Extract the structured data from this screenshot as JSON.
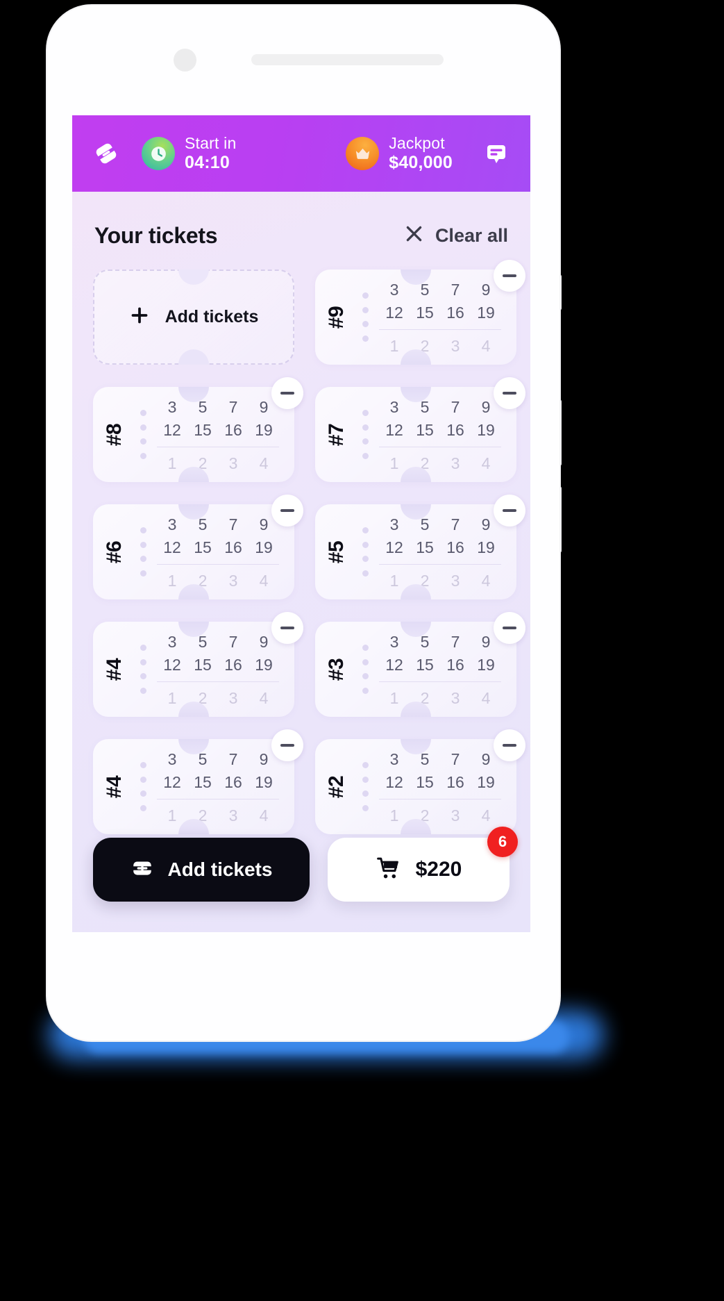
{
  "header": {
    "logo_icon": "ticket-icon",
    "clock_icon": "clock-icon",
    "crown_icon": "crown-icon",
    "chat_icon": "chat-bubble-icon",
    "start_label": "Start in",
    "start_value": "04:10",
    "jackpot_label": "Jackpot",
    "jackpot_value": "$40,000",
    "bar_color_from": "#c13ef0",
    "bar_color_to": "#a64cf5"
  },
  "section": {
    "title": "Your tickets",
    "clear_label": "Clear all",
    "close_icon": "close-x-icon"
  },
  "add_card": {
    "label": "Add tickets",
    "icon": "plus-icon"
  },
  "tickets": [
    {
      "id": "#9",
      "rows": [
        [
          "3",
          "5",
          "7",
          "9"
        ],
        [
          "12",
          "15",
          "16",
          "19"
        ],
        [
          "1",
          "2",
          "3",
          "4"
        ]
      ],
      "remove_icon": "minus-circle-icon"
    },
    {
      "id": "#8",
      "rows": [
        [
          "3",
          "5",
          "7",
          "9"
        ],
        [
          "12",
          "15",
          "16",
          "19"
        ],
        [
          "1",
          "2",
          "3",
          "4"
        ]
      ],
      "remove_icon": "minus-circle-icon"
    },
    {
      "id": "#7",
      "rows": [
        [
          "3",
          "5",
          "7",
          "9"
        ],
        [
          "12",
          "15",
          "16",
          "19"
        ],
        [
          "1",
          "2",
          "3",
          "4"
        ]
      ],
      "remove_icon": "minus-circle-icon"
    },
    {
      "id": "#6",
      "rows": [
        [
          "3",
          "5",
          "7",
          "9"
        ],
        [
          "12",
          "15",
          "16",
          "19"
        ],
        [
          "1",
          "2",
          "3",
          "4"
        ]
      ],
      "remove_icon": "minus-circle-icon"
    },
    {
      "id": "#5",
      "rows": [
        [
          "3",
          "5",
          "7",
          "9"
        ],
        [
          "12",
          "15",
          "16",
          "19"
        ],
        [
          "1",
          "2",
          "3",
          "4"
        ]
      ],
      "remove_icon": "minus-circle-icon"
    },
    {
      "id": "#4",
      "rows": [
        [
          "3",
          "5",
          "7",
          "9"
        ],
        [
          "12",
          "15",
          "16",
          "19"
        ],
        [
          "1",
          "2",
          "3",
          "4"
        ]
      ],
      "remove_icon": "minus-circle-icon"
    },
    {
      "id": "#3",
      "rows": [
        [
          "3",
          "5",
          "7",
          "9"
        ],
        [
          "12",
          "15",
          "16",
          "19"
        ],
        [
          "1",
          "2",
          "3",
          "4"
        ]
      ],
      "remove_icon": "minus-circle-icon"
    },
    {
      "id": "#4",
      "rows": [
        [
          "3",
          "5",
          "7",
          "9"
        ],
        [
          "12",
          "15",
          "16",
          "19"
        ],
        [
          "1",
          "2",
          "3",
          "4"
        ]
      ],
      "remove_icon": "minus-circle-icon"
    },
    {
      "id": "#2",
      "rows": [
        [
          "3",
          "5",
          "7",
          "9"
        ],
        [
          "12",
          "15",
          "16",
          "19"
        ],
        [
          "1",
          "2",
          "3",
          "4"
        ]
      ],
      "remove_icon": "minus-circle-icon"
    }
  ],
  "footer": {
    "add_label": "Add tickets",
    "add_icon": "ticket-plus-icon",
    "cart_icon": "shopping-cart-icon",
    "cart_price": "$220",
    "cart_badge": "6",
    "badge_color": "#f02020"
  }
}
